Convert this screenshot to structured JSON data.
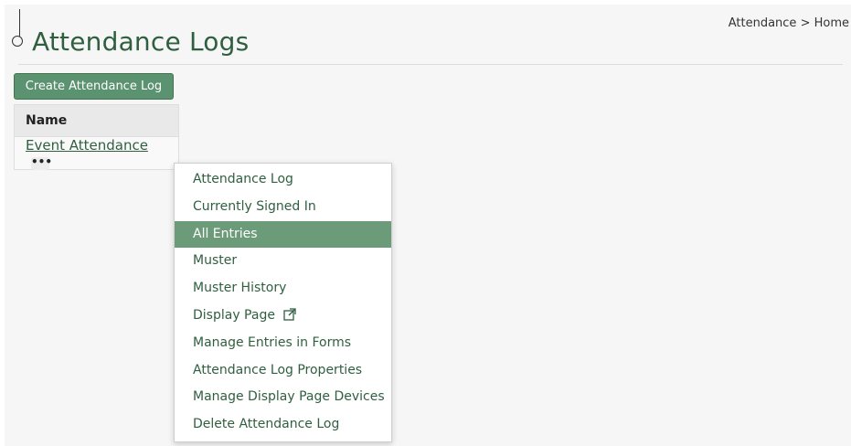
{
  "header": {
    "title": "Attendance Logs",
    "breadcrumb": [
      "Attendance",
      ">",
      "Home"
    ]
  },
  "toolbar": {
    "create_label": "Create Attendance Log"
  },
  "table": {
    "columns": [
      "Name"
    ],
    "rows": [
      {
        "name": "Event Attendance",
        "more_icon": "more-horizontal-icon"
      }
    ]
  },
  "menu": {
    "items": [
      {
        "label": "Attendance Log"
      },
      {
        "label": "Currently Signed In"
      },
      {
        "label": "All Entries",
        "highlighted": true
      },
      {
        "label": "Muster"
      },
      {
        "label": "Muster History"
      },
      {
        "label": "Display Page",
        "icon": "external-link-icon"
      },
      {
        "label": "Manage Entries in Forms"
      },
      {
        "label": "Attendance Log Properties"
      },
      {
        "label": "Manage Display Page Devices"
      },
      {
        "label": "Delete Attendance Log"
      }
    ]
  },
  "colors": {
    "accent": "#5b9270",
    "highlight": "#6b9b78",
    "link": "#2f5f3f"
  }
}
